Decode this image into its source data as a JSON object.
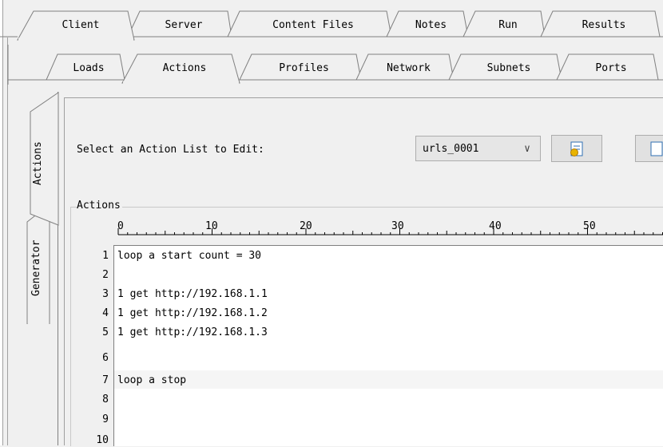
{
  "top_tabs": [
    "Client",
    "Server",
    "Content Files",
    "Notes",
    "Run",
    "Results"
  ],
  "second_tabs": [
    "Loads",
    "Actions",
    "Profiles",
    "Network",
    "Subnets",
    "Ports"
  ],
  "side_tabs": [
    "Actions",
    "Generator"
  ],
  "select_label": "Select an Action List to Edit:",
  "dropdown": {
    "value": "urls_0001",
    "arrow": "∨"
  },
  "group_label": "Actions",
  "ruler": [
    "0",
    "10",
    "20",
    "30",
    "40",
    "50"
  ],
  "lines": [
    {
      "num": "1",
      "text": "loop a start count = 30"
    },
    {
      "num": "2",
      "text": ""
    },
    {
      "num": "3",
      "text": "1 get http://192.168.1.1"
    },
    {
      "num": "4",
      "text": "1 get http://192.168.1.2"
    },
    {
      "num": "5",
      "text": "1 get http://192.168.1.3"
    },
    {
      "num": "6",
      "text": ""
    },
    {
      "num": "7",
      "text": "loop a stop"
    },
    {
      "num": "8",
      "text": ""
    },
    {
      "num": "9",
      "text": ""
    },
    {
      "num": "10",
      "text": ""
    }
  ],
  "icons": {
    "new_list": "new-action-list-icon",
    "edit_list": "edit-list-icon"
  }
}
